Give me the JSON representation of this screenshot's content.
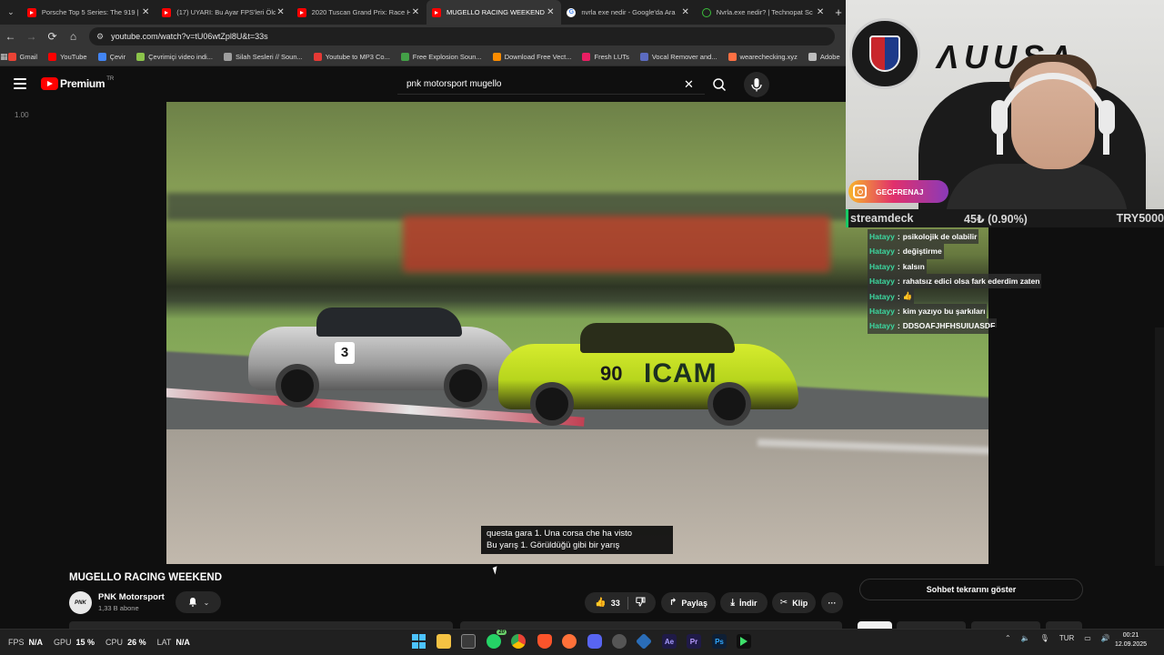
{
  "browser": {
    "tabs": [
      {
        "label": "Porsche Top 5 Series: The 919 |",
        "icon": "youtube-icon",
        "active": false
      },
      {
        "label": "(17) UYARI: Bu Ayar FPS'leri Öld",
        "icon": "youtube-icon",
        "active": false
      },
      {
        "label": "2020 Tuscan Grand Prix: Race H",
        "icon": "youtube-icon",
        "active": false
      },
      {
        "label": "MUGELLO RACING WEEKEND -",
        "icon": "youtube-icon",
        "active": true
      },
      {
        "label": "nvrla exe nedir - Google'da Ara",
        "icon": "google-icon",
        "active": false
      },
      {
        "label": "Nvrla.exe nedir? | Technopat Sc",
        "icon": "technopat-icon",
        "active": false
      }
    ],
    "url": "youtube.com/watch?v=tU06wtZpl8U&t=33s",
    "bookmarks": [
      {
        "label": "Gmail",
        "color": "#ea4335"
      },
      {
        "label": "YouTube",
        "color": "#ff0000"
      },
      {
        "label": "Çevir",
        "color": "#4285f4"
      },
      {
        "label": "Çevrimiçi video indi...",
        "color": "#8bc34a"
      },
      {
        "label": "Silah Sesleri // Soun...",
        "color": "#9e9e9e"
      },
      {
        "label": "Youtube to MP3 Co...",
        "color": "#e53935"
      },
      {
        "label": "Free Explosion Soun...",
        "color": "#43a047"
      },
      {
        "label": "Download Free Vect...",
        "color": "#fb8c00"
      },
      {
        "label": "Fresh LUTs",
        "color": "#e91e63"
      },
      {
        "label": "Vocal Remover and...",
        "color": "#5c6bc0"
      },
      {
        "label": "wearechecking.xyz",
        "color": "#ff7043"
      },
      {
        "label": "Adobe",
        "color": "#bdbdbd"
      }
    ]
  },
  "youtube": {
    "logo": "Premium",
    "country": "TR",
    "search_query": "pnk motorsport mugello",
    "speed_label": "1.00",
    "subtitle_line1": "questa gara 1. Una corsa che ha visto",
    "subtitle_line2": "Bu yarış 1. Görüldüğü gibi bir yarış",
    "car_number_grey": "3",
    "car_number_yellow": "90",
    "car_sponsor_yellow": "ICAM",
    "video_title": "MUGELLO RACING WEEKEND",
    "channel_name": "PNK Motorsport",
    "channel_avatar": "PNK",
    "subscribers": "1,33 B abone",
    "like_count": "33",
    "share_label": "Paylaş",
    "download_label": "İndir",
    "clip_label": "Klip",
    "show_chat_label": "Sohbet tekrarını göster"
  },
  "overlay": {
    "instagram_handle": "GECFRENAJ",
    "brand_text": "AUUSA",
    "ticker": {
      "name": "streamdeck",
      "price": "45₺ (0.90%)",
      "goal": "TRY5000"
    },
    "chat": [
      {
        "user": "Hatayy",
        "message": "psikolojik de olabilir"
      },
      {
        "user": "Hatayy",
        "message": "değiştirme"
      },
      {
        "user": "Hatayy",
        "message": "kalsın"
      },
      {
        "user": "Hatayy",
        "message": "rahatsız edici olsa fark ederdim zaten"
      },
      {
        "user": "Hatayy",
        "message": "👍"
      },
      {
        "user": "Hatayy",
        "message": "kim yazıyo bu şarkıları"
      },
      {
        "user": "Hatayy",
        "message": "DDSOAFJHFHSUIUASDF"
      }
    ]
  },
  "taskbar": {
    "fps_label": "FPS",
    "fps_value": "N/A",
    "gpu_label": "GPU",
    "gpu_value": "15 %",
    "cpu_label": "CPU",
    "cpu_value": "26 %",
    "lat_label": "LAT",
    "lat_value": "N/A",
    "language": "TUR",
    "time": "00:21",
    "date": "12.09.2025",
    "whatsapp_badge": "20"
  }
}
